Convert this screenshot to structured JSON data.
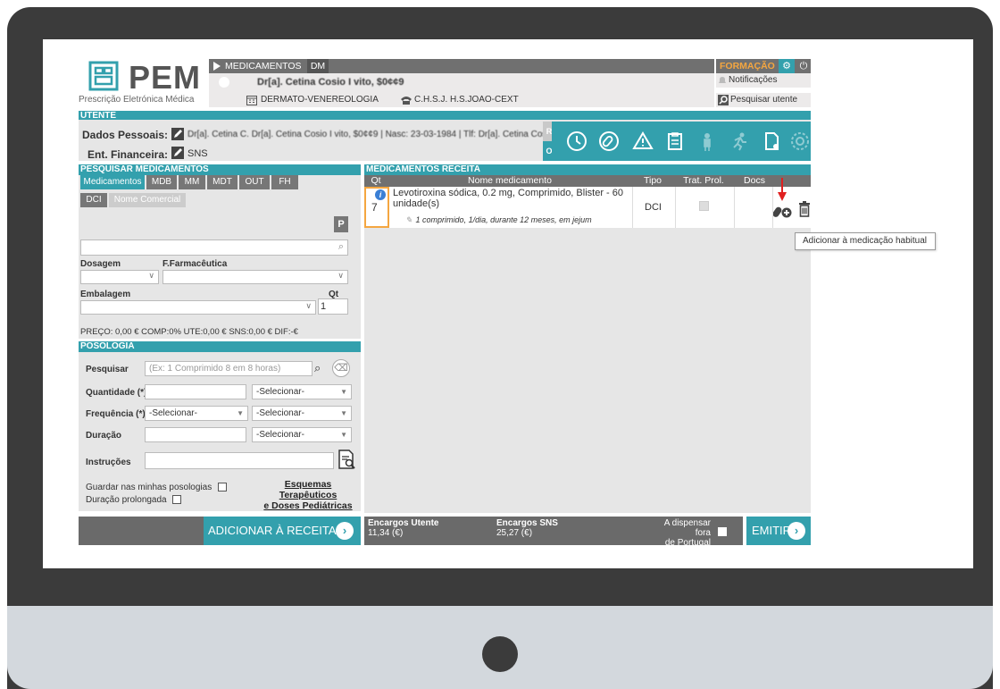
{
  "logo": {
    "text": "PEM",
    "subtitle": "Prescrição Eletrónica Médica"
  },
  "header": {
    "tab_medicamentos": "MEDICAMENTOS",
    "tab_dm": "DM",
    "patient_name": "Dr[a]. Cetina Cosio I vito, $0¢¢9",
    "specialty": "DERMATO-VENEREOLOGIA",
    "institution": "C.H.S.J. H.S.JOAO-CEXT",
    "formacao": "FORMAÇÃO",
    "notificacoes": "Notificações",
    "pesquisar_utente": "Pesquisar utente"
  },
  "utente": {
    "section_title": "UTENTE",
    "dados_label": "Dados Pessoais:",
    "dados_value": "Dr[a]. Cetina C. Dr[a]. Cetina Cosio I vito, $0¢¢9 | Nasc: 23-03-1984 | Tlf: Dr[a]. Cetina Cosio I.o",
    "ent_label": "Ent. Financeira:",
    "ent_value": "SNS",
    "badge_r": "R",
    "badge_o": "O"
  },
  "pesquisar": {
    "section_title": "PESQUISAR MEDICAMENTOS",
    "tabs": [
      "Medicamentos",
      "MDB",
      "MM",
      "MDT",
      "OUT",
      "FH"
    ],
    "subtabs": [
      "DCI",
      "Nome Comercial"
    ],
    "dosagem": "Dosagem",
    "forma": "F.Farmacêutica",
    "embalagem": "Embalagem",
    "qt": "Qt",
    "qt_value": "1",
    "p_button": "P"
  },
  "precos": "PREÇO: 0,00 € COMP:0% UTE:0,00 € SNS:0,00 € DIF:-€",
  "posologia": {
    "section_title": "POSOLOGIA",
    "pesquisar_label": "Pesquisar",
    "pesquisar_placeholder": "(Ex: 1 Comprimido 8 em 8 horas)",
    "quantidade_label": "Quantidade (*)",
    "frequencia_label": "Frequência (*)",
    "duracao_label": "Duração",
    "instrucoes_label": "Instruções",
    "selecionar": "-Selecionar-",
    "guardar": "Guardar nas minhas posologias",
    "prolongada": "Duração prolongada",
    "esquemas_1": "Esquemas Terapêuticos",
    "esquemas_2": "e Doses Pediátricas"
  },
  "receita": {
    "section_title": "MEDICAMENTOS RECEITA",
    "columns": [
      "Qt",
      "Nome medicamento",
      "Tipo",
      "Trat. Prol.",
      "Docs"
    ],
    "row": {
      "qt": "7",
      "name": "Levotiroxina sódica, 0.2 mg, Comprimido, Blister - 60 unidade(s)",
      "posologia": "1 comprimido, 1/dia, durante 12 meses, em jejum",
      "tipo": "DCI"
    },
    "tooltip": "Adicionar à medicação habitual"
  },
  "footer": {
    "adicionar": "ADICIONAR À RECEITA",
    "encargos_utente_label": "Encargos Utente",
    "encargos_utente_value": "11,34 (€)",
    "encargos_sns_label": "Encargos SNS",
    "encargos_sns_value": "25,27 (€)",
    "dispensar_1": "A dispensar fora",
    "dispensar_2": "de Portugal",
    "emitir": "EMITIR"
  },
  "colors": {
    "teal": "#33a0ad",
    "gray_bar": "#707070",
    "panel": "#e6e6e6",
    "accent_orange": "#f4a640",
    "arrow_red": "#e02020"
  }
}
